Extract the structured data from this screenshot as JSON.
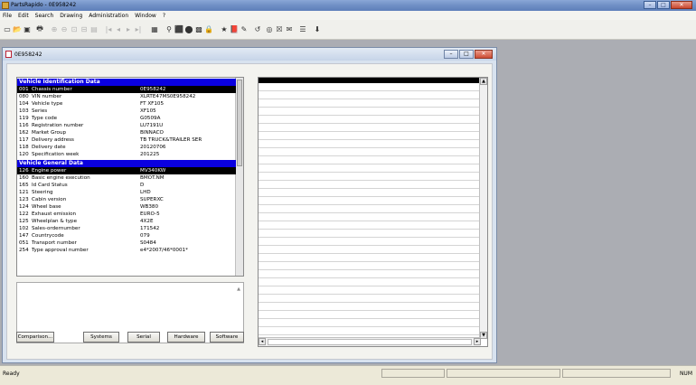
{
  "window": {
    "title": "PartsRapido - 0E958242",
    "min": "–",
    "max": "□",
    "close": "✕"
  },
  "menu": [
    "File",
    "Edit",
    "Search",
    "Drawing",
    "Administration",
    "Window",
    "?"
  ],
  "toolbar": {
    "icons": [
      "new-icon",
      "open-icon",
      "save-icon",
      "print-icon",
      "zoom-in-icon",
      "zoom-out-icon",
      "zoom-fit-icon",
      "zoom-page-icon",
      "toolbar-disabled-icon",
      "first-icon",
      "prev-icon",
      "next-icon",
      "last-icon",
      "catalog-icon",
      "binoculars-icon",
      "vehicle-icon",
      "record-icon",
      "flag-icon",
      "lock-icon",
      "star-icon",
      "book-icon",
      "pencil-icon",
      "refresh-icon",
      "target-icon",
      "cross-icon",
      "mail-icon",
      "list-icon",
      "cart-icon"
    ],
    "glyphs": [
      "▭",
      "📂",
      "▣",
      "🖶",
      "⊕",
      "⊖",
      "⊡",
      "⊟",
      "▤",
      "|◂",
      "◂",
      "▸",
      "▸|",
      "▦",
      "⚲",
      "⬛",
      "⬤",
      "▩",
      "🔒",
      "★",
      "📕",
      "✎",
      "↺",
      "◎",
      "☒",
      "✉",
      "☰",
      "⬇"
    ]
  },
  "child": {
    "title": "0E958242",
    "min": "–",
    "max": "□",
    "close": "✕"
  },
  "sections": [
    {
      "header": "Vehicle Identification Data",
      "rows": [
        {
          "code": "001",
          "label": "Chassis number",
          "value": "0E958242",
          "selected": true
        },
        {
          "code": "080",
          "label": "VIN number",
          "value": "XLRTE47MS0E958242"
        },
        {
          "code": "104",
          "label": "Vehicle type",
          "value": "FT XF105"
        },
        {
          "code": "103",
          "label": "Series",
          "value": "XF105"
        },
        {
          "code": "119",
          "label": "Type code",
          "value": "G0509A"
        },
        {
          "code": "116",
          "label": "Registration number",
          "value": "LU7191U"
        },
        {
          "code": "162",
          "label": "Market Group",
          "value": "BINNACO"
        },
        {
          "code": "117",
          "label": "Delivery address",
          "value": "TB TRUCK&TRAILER SER"
        },
        {
          "code": "118",
          "label": "Delivery date",
          "value": "20120706"
        },
        {
          "code": "120",
          "label": "Specification week",
          "value": "201225"
        }
      ]
    },
    {
      "header": "Vehicle General Data",
      "rows": [
        {
          "code": "126",
          "label": "Engine power",
          "value": "MV340KW",
          "selected": true
        },
        {
          "code": "160",
          "label": "Basic engine execution",
          "value": "BMOT.NM"
        },
        {
          "code": "165",
          "label": "Id Card Status",
          "value": "D"
        },
        {
          "code": "121",
          "label": "Steering",
          "value": "LHD"
        },
        {
          "code": "123",
          "label": "Cabin version",
          "value": "SUPERXC"
        },
        {
          "code": "124",
          "label": "Wheel base",
          "value": "WB380"
        },
        {
          "code": "122",
          "label": "Exhaust emission",
          "value": "EURO-5"
        },
        {
          "code": "125",
          "label": "Wheelplan & type",
          "value": "4X2E"
        },
        {
          "code": "102",
          "label": "Sales-ordernumber",
          "value": "171542"
        },
        {
          "code": "147",
          "label": "Countrycode",
          "value": "079"
        },
        {
          "code": "051",
          "label": "Transport number",
          "value": "S0484"
        },
        {
          "code": "254",
          "label": "Type approval number",
          "value": "e4*2007/46*0001*"
        }
      ]
    }
  ],
  "buttons": {
    "comparison": "Comparison...",
    "systems": "Systems",
    "serial": "Serial",
    "hardware": "Hardware",
    "software": "Software"
  },
  "status": {
    "ready": "Ready",
    "num": "NUM"
  }
}
